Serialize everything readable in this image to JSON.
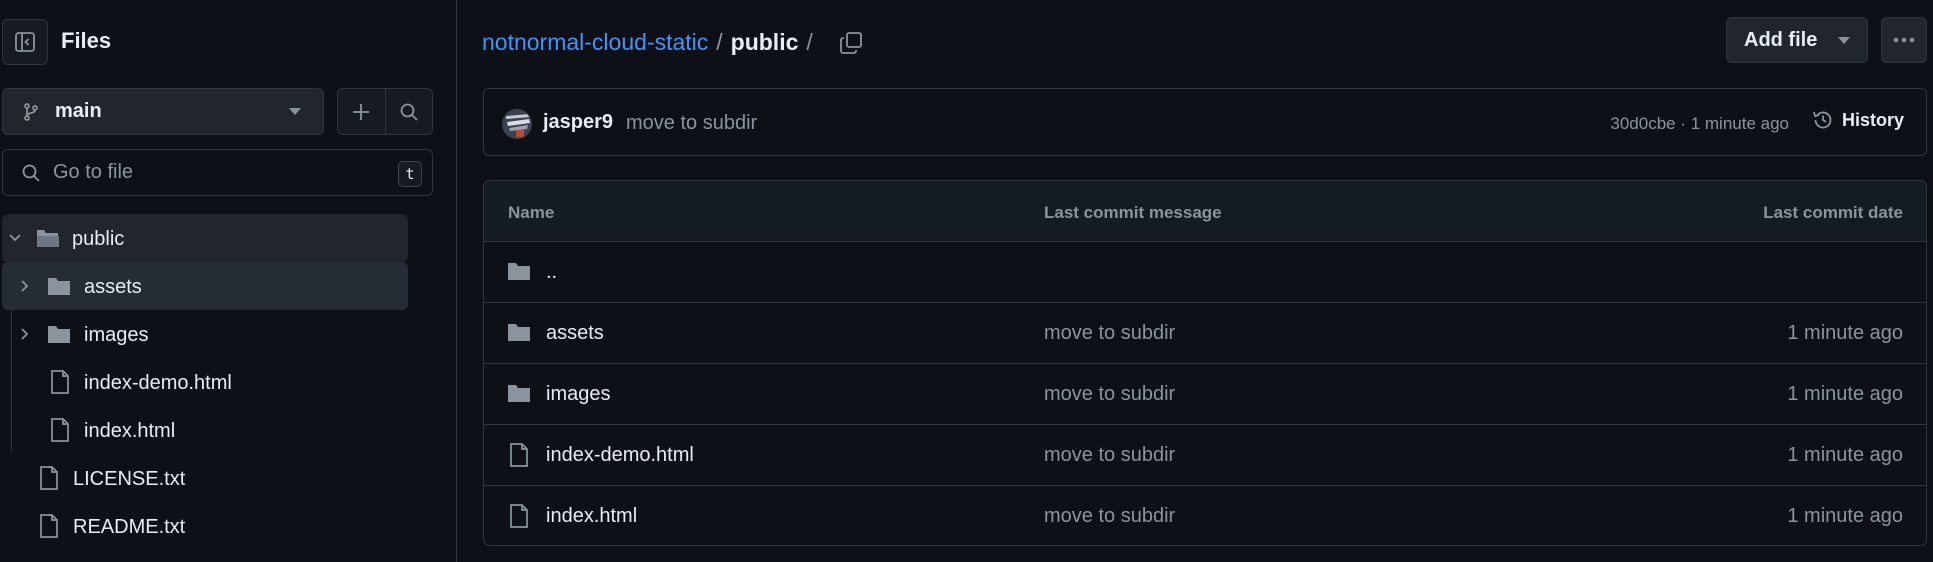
{
  "sidebar": {
    "title": "Files",
    "branch": "main",
    "goto_placeholder": "Go to file",
    "goto_shortcut": "t",
    "tree": [
      {
        "label": "public",
        "type": "folder-open",
        "expanded": true
      },
      {
        "label": "assets",
        "type": "folder",
        "expanded": false
      },
      {
        "label": "images",
        "type": "folder",
        "expanded": false
      },
      {
        "label": "index-demo.html",
        "type": "file"
      },
      {
        "label": "index.html",
        "type": "file"
      },
      {
        "label": "LICENSE.txt",
        "type": "file"
      },
      {
        "label": "README.txt",
        "type": "file"
      }
    ]
  },
  "breadcrumb": {
    "repo": "notnormal-cloud-static",
    "separator": "/",
    "current": "public"
  },
  "actions": {
    "add_file": "Add file"
  },
  "commit": {
    "author": "jasper9",
    "message": "move to subdir",
    "meta": "30d0cbe · 1 minute ago",
    "history_label": "History"
  },
  "table": {
    "headers": {
      "name": "Name",
      "message": "Last commit message",
      "date": "Last commit date"
    },
    "rows": [
      {
        "name": "..",
        "type": "folder",
        "message": "",
        "date": ""
      },
      {
        "name": "assets",
        "type": "folder",
        "message": "move to subdir",
        "date": "1 minute ago"
      },
      {
        "name": "images",
        "type": "folder",
        "message": "move to subdir",
        "date": "1 minute ago"
      },
      {
        "name": "index-demo.html",
        "type": "file",
        "message": "move to subdir",
        "date": "1 minute ago"
      },
      {
        "name": "index.html",
        "type": "file",
        "message": "move to subdir",
        "date": "1 minute ago"
      }
    ]
  },
  "colors": {
    "background": "#0d1117",
    "link": "#4493f8",
    "muted": "#8b949e",
    "border": "#30363d",
    "folder": "#8b949e"
  }
}
